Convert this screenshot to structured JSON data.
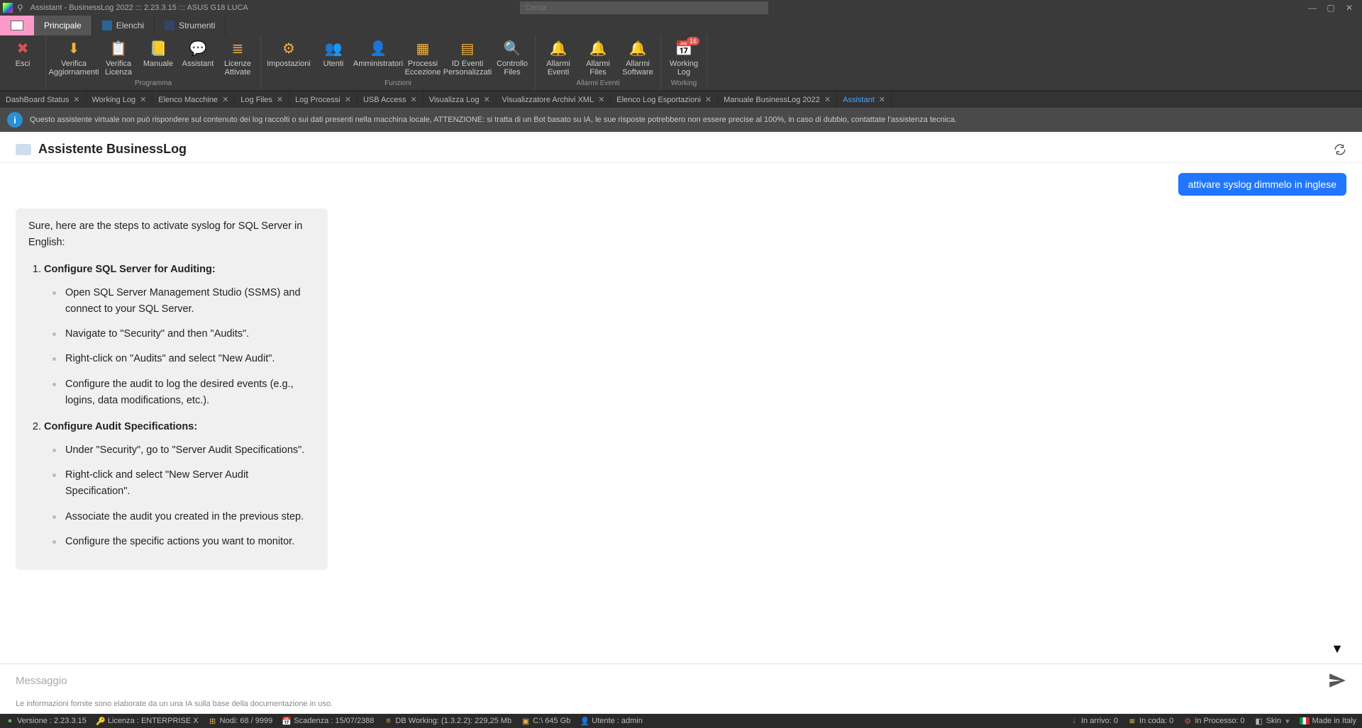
{
  "window": {
    "title": "Assistant - BusinessLog 2022 ::: 2.23.3.15 ::: ASUS G18 LUCA",
    "search_placeholder": "Cerca"
  },
  "menu_tabs": [
    {
      "label": "Principale",
      "active": true
    },
    {
      "label": "Elenchi",
      "active": false
    },
    {
      "label": "Strumenti",
      "active": false
    }
  ],
  "ribbon": {
    "groups": [
      {
        "label": "",
        "items": [
          {
            "label": "Esci",
            "icon": "exit-icon"
          }
        ]
      },
      {
        "label": "Programma",
        "items": [
          {
            "label": "Verifica Aggiornamenti",
            "icon": "download-icon"
          },
          {
            "label": "Verifica Licenza",
            "icon": "license-icon"
          },
          {
            "label": "Manuale",
            "icon": "book-icon"
          },
          {
            "label": "Assistant",
            "icon": "chat-icon"
          },
          {
            "label": "Licenze Attivate",
            "icon": "list-icon"
          }
        ]
      },
      {
        "label": "Funzioni",
        "items": [
          {
            "label": "Impostazioni",
            "icon": "gear-icon"
          },
          {
            "label": "Utenti",
            "icon": "users-icon"
          },
          {
            "label": "Amministratori",
            "icon": "admin-icon"
          },
          {
            "label": "Processi Eccezione",
            "icon": "process-icon"
          },
          {
            "label": "ID Eventi Personalizzati",
            "icon": "events-icon"
          },
          {
            "label": "Controllo Files",
            "icon": "file-check-icon"
          }
        ]
      },
      {
        "label": "Allarmi Eventi",
        "items": [
          {
            "label": "Allarmi Eventi",
            "icon": "bell-icon"
          },
          {
            "label": "Allarmi Files",
            "icon": "bell-file-icon"
          },
          {
            "label": "Allarmi Software",
            "icon": "bell-lock-icon"
          }
        ]
      },
      {
        "label": "Working",
        "items": [
          {
            "label": "Working Log",
            "icon": "worklog-icon",
            "badge": "16"
          }
        ]
      }
    ]
  },
  "doc_tabs": [
    {
      "label": "DashBoard Status"
    },
    {
      "label": "Working Log"
    },
    {
      "label": "Elenco Macchine"
    },
    {
      "label": "Log Files"
    },
    {
      "label": "Log Processi"
    },
    {
      "label": "USB Access"
    },
    {
      "label": "Visualizza Log"
    },
    {
      "label": "Visualizzatore Archivi XML"
    },
    {
      "label": "Elenco Log Esportazioni"
    },
    {
      "label": "Manuale BusinessLog 2022"
    },
    {
      "label": "Assistant",
      "active": true
    }
  ],
  "info_banner": "Questo assistente virtuale non può rispondere sul contenuto dei log raccolti o sui dati presenti nella macchina locale, ATTENZIONE: si tratta di un Bot basato su IA, le sue risposte potrebbero non essere precise al 100%, in caso di dubbio, contattate l'assistenza tecnica.",
  "chat": {
    "title": "Assistente BusinessLog",
    "user_message": "attivare syslog dimmelo in inglese",
    "bot": {
      "intro": "Sure, here are the steps to activate syslog for SQL Server in English:",
      "sections": [
        {
          "title": "Configure SQL Server for Auditing:",
          "bullets": [
            "Open SQL Server Management Studio (SSMS) and connect to your SQL Server.",
            "Navigate to \"Security\" and then \"Audits\".",
            "Right-click on \"Audits\" and select \"New Audit\".",
            "Configure the audit to log the desired events (e.g., logins, data modifications, etc.)."
          ]
        },
        {
          "title": "Configure Audit Specifications:",
          "bullets": [
            "Under \"Security\", go to \"Server Audit Specifications\".",
            "Right-click and select \"New Server Audit Specification\".",
            "Associate the audit you created in the previous step.",
            "Configure the specific actions you want to monitor."
          ]
        }
      ]
    },
    "input_placeholder": "Messaggio",
    "disclaimer": "Le informazioni fornite sono elaborate da un una IA sulla base della documentazione in uso."
  },
  "status": {
    "versione": "Versione : 2.23.3.15",
    "licenza": "Licenza : ENTERPRISE X",
    "nodi": "Nodi: 68 / 9999",
    "scadenza": "Scadenza : 15/07/2388",
    "db": "DB Working: (1.3.2.2): 229,25 Mb",
    "disk": "C:\\ 645 Gb",
    "utente": "Utente : admin",
    "in_arrivo": "In arrivo: 0",
    "in_coda": "In coda: 0",
    "in_processo": "In Processo: 0",
    "skin": "Skin",
    "made": "Made in Italy"
  },
  "colors": {
    "accent": "#2176ff",
    "ribbon_icon": "#f3b23c"
  }
}
